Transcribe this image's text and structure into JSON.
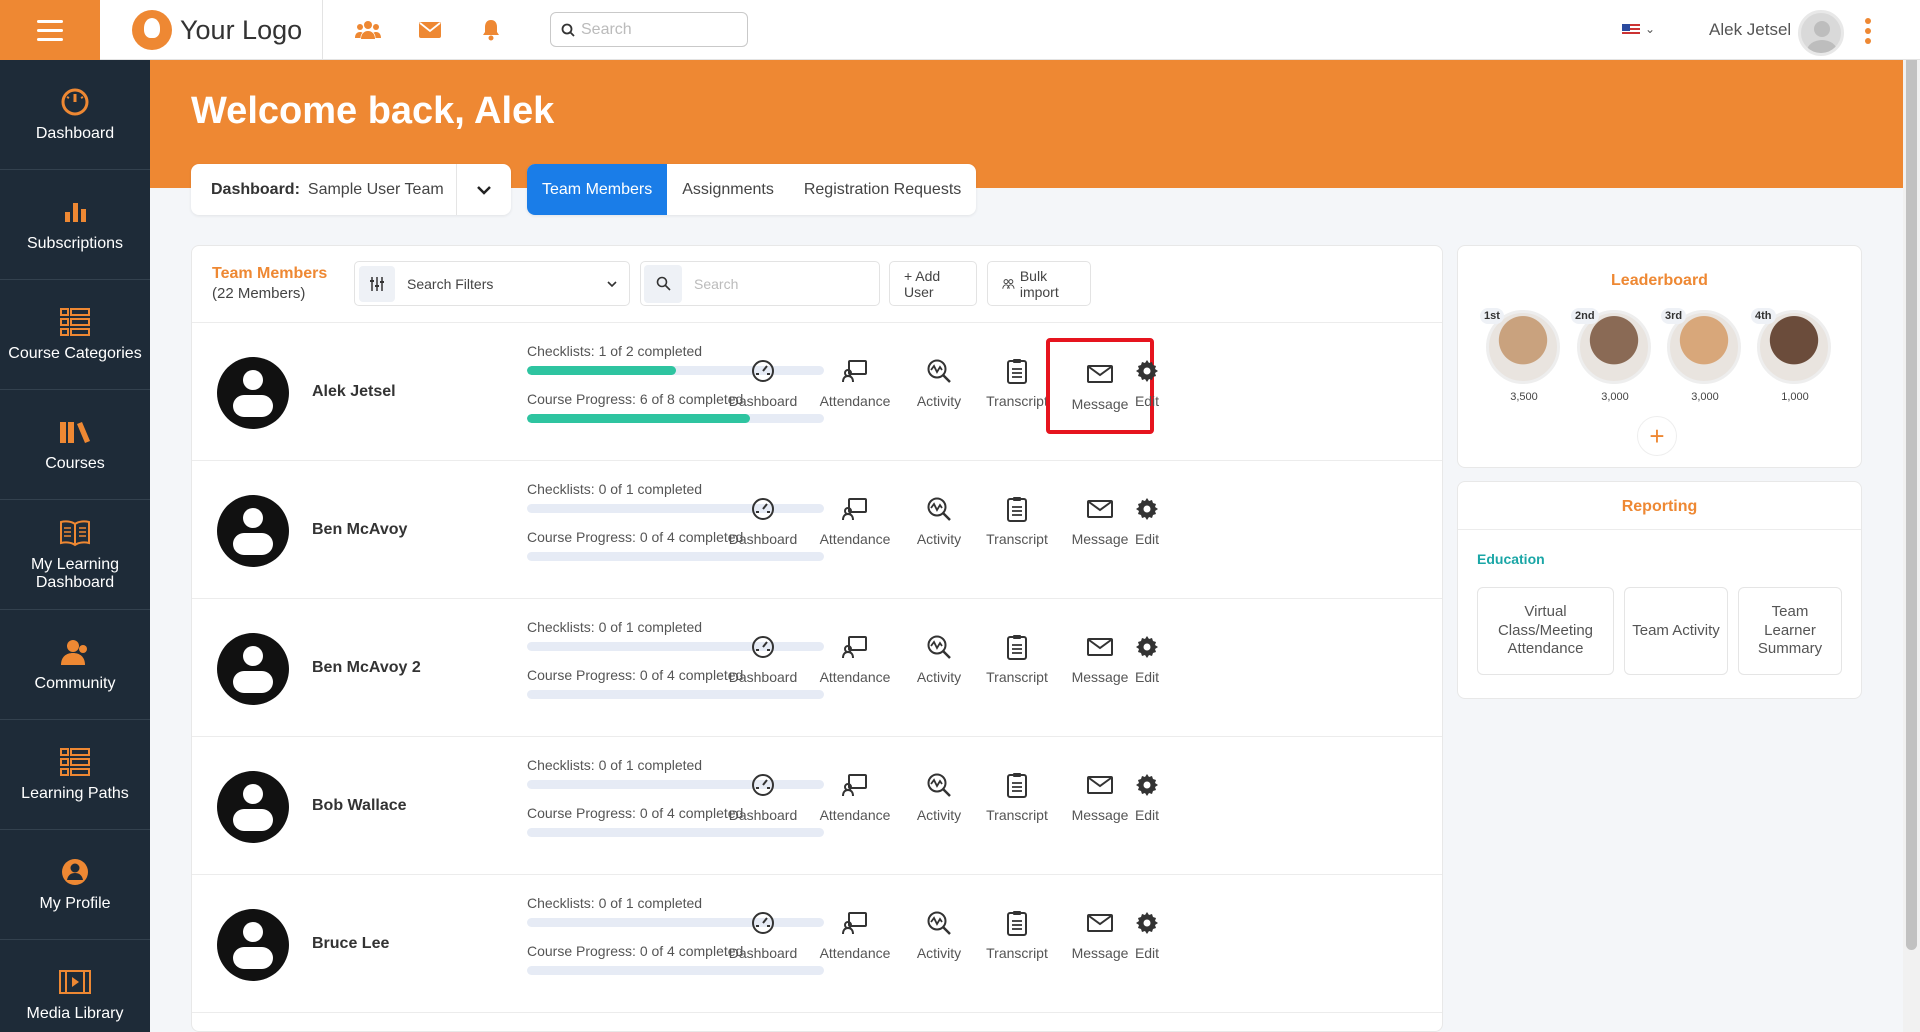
{
  "topbar": {
    "logo_text": "Your Logo",
    "search_placeholder": "Search",
    "username": "Alek Jetsel",
    "icons": [
      "team-icon",
      "mail-icon",
      "bell-icon"
    ],
    "accent_color": "#ee8833"
  },
  "sidebar": {
    "items": [
      {
        "label": "Dashboard",
        "icon": "gauge-icon"
      },
      {
        "label": "Subscriptions",
        "icon": "bar-chart-icon"
      },
      {
        "label": "Course Categories",
        "icon": "grid-list-icon"
      },
      {
        "label": "Courses",
        "icon": "books-icon"
      },
      {
        "label": "My Learning Dashboard",
        "icon": "open-book-icon"
      },
      {
        "label": "Community",
        "icon": "people-icon"
      },
      {
        "label": "Learning Paths",
        "icon": "grid-list-icon"
      },
      {
        "label": "My Profile",
        "icon": "user-circle-icon"
      },
      {
        "label": "Media Library",
        "icon": "film-icon"
      }
    ]
  },
  "header": {
    "welcome": "Welcome back, Alek",
    "dashboard_label": "Dashboard:",
    "dashboard_value": "Sample User Team",
    "tabs": [
      "Team Members",
      "Assignments",
      "Registration Requests"
    ],
    "active_tab": "Team Members"
  },
  "toolbar": {
    "title": "Team Members",
    "count": "(22 Members)",
    "filter_label": "Search Filters",
    "search_placeholder": "Search",
    "add_user": "+ Add User",
    "bulk_import": "Bulk import"
  },
  "actions": [
    "Dashboard",
    "Attendance",
    "Activity",
    "Transcript",
    "Message",
    "Edit"
  ],
  "members": [
    {
      "name": "Alek Jetsel",
      "checklists": "Checklists: 1 of 2 completed",
      "checklist_pct": 50,
      "course": "Course Progress: 6 of 8 completed",
      "course_pct": 75
    },
    {
      "name": "Ben McAvoy",
      "checklists": "Checklists: 0 of 1 completed",
      "checklist_pct": 0,
      "course": "Course Progress: 0 of 4 completed",
      "course_pct": 0
    },
    {
      "name": "Ben McAvoy 2",
      "checklists": "Checklists: 0 of 1 completed",
      "checklist_pct": 0,
      "course": "Course Progress: 0 of 4 completed",
      "course_pct": 0
    },
    {
      "name": "Bob Wallace",
      "checklists": "Checklists: 0 of 1 completed",
      "checklist_pct": 0,
      "course": "Course Progress: 0 of 4 completed",
      "course_pct": 0
    },
    {
      "name": "Bruce Lee",
      "checklists": "Checklists: 0 of 1 completed",
      "checklist_pct": 0,
      "course": "Course Progress: 0 of 4 completed",
      "course_pct": 0
    }
  ],
  "leaderboard": {
    "title": "Leaderboard",
    "leaders": [
      {
        "rank": "1st",
        "points": "3,500",
        "color": "#c9a27e"
      },
      {
        "rank": "2nd",
        "points": "3,000",
        "color": "#8a6a55"
      },
      {
        "rank": "3rd",
        "points": "3,000",
        "color": "#d8a77a"
      },
      {
        "rank": "4th",
        "points": "1,000",
        "color": "#6b4c3b"
      }
    ],
    "add": "+"
  },
  "reporting": {
    "title": "Reporting",
    "section": "Education",
    "cards": [
      "Virtual Class/Meeting Attendance",
      "Team Activity",
      "Team Learner Summary"
    ]
  }
}
